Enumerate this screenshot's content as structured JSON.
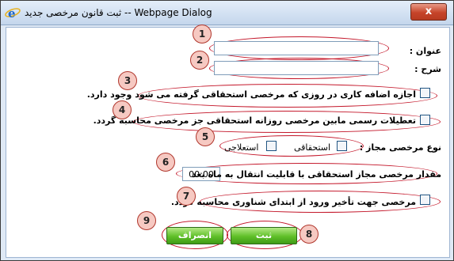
{
  "window": {
    "title": "ثبت قانون مرخصی جدید -- Webpage Dialog",
    "close_label": "x"
  },
  "form": {
    "title_label": "عنوان :",
    "title_value": "",
    "description_label": "شرح :",
    "description_value": "",
    "checkbox_3_label": "اجازه اضافه کاری در روزی که مرخصی استحقاقی گرفته می شود وجود دارد.",
    "checkbox_3_checked": false,
    "checkbox_4_label": "تعطیلات رسمی مابین مرخصی روزانه استحقاقی جز مرخصی محاسبه گردد.",
    "checkbox_4_checked": false,
    "leave_type_label": "نوع مرخصی مجاز :",
    "leave_type_entitled": "استحقاقی",
    "leave_type_entitled_checked": false,
    "leave_type_sick": "استعلاجی",
    "leave_type_sick_checked": false,
    "transfer_label": "مقدار مرخصی مجاز استحقاقی با قابلیت انتقال به ماه بعد",
    "transfer_value": "00:00",
    "checkbox_7_label": "مرخصی جهت تأخیر ورود از ابتدای شناوری محاسبه گردد.",
    "checkbox_7_checked": false
  },
  "buttons": {
    "submit_label": "ثبت",
    "cancel_label": "انصراف"
  },
  "annotations": [
    "1",
    "2",
    "3",
    "4",
    "5",
    "6",
    "7",
    "8",
    "9"
  ],
  "colors": {
    "annotation_outline": "#c4182b",
    "annotation_fill": "#f6c9c2",
    "button_green": "#5fbf28"
  }
}
